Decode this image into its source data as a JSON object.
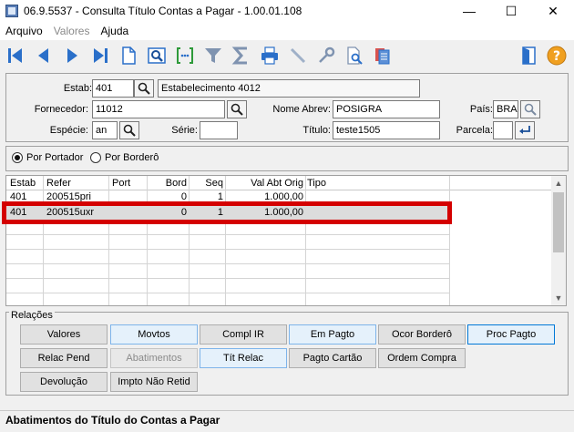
{
  "window": {
    "title": "06.9.5537 - Consulta Título Contas a Pagar - 1.00.01.108",
    "minimize": "—",
    "maximize": "☐",
    "close": "✕"
  },
  "menu": {
    "items": [
      "Arquivo",
      "Valores",
      "Ajuda"
    ]
  },
  "toolbar": {
    "icons": [
      "first-record-icon",
      "previous-record-icon",
      "next-record-icon",
      "last-record-icon",
      "new-document-icon",
      "search-icon",
      "goto-icon",
      "filter-icon",
      "sum-icon",
      "print-icon",
      "pen-icon",
      "key-icon",
      "document-search-icon",
      "documents-icon",
      "exit-icon",
      "help-icon"
    ]
  },
  "form": {
    "estab_label": "Estab:",
    "estab_value": "401",
    "estab_desc": "Estabelecimento 4012",
    "fornecedor_label": "Fornecedor:",
    "fornecedor_value": "11012",
    "nome_abrev_label": "Nome Abrev:",
    "nome_abrev_value": "POSIGRA",
    "pais_label": "País:",
    "pais_value": "BRA",
    "especie_label": "Espécie:",
    "especie_value": "an",
    "serie_label": "Série:",
    "serie_value": "",
    "titulo_label": "Título:",
    "titulo_value": "teste1505",
    "parcela_label": "Parcela:",
    "parcela_value": ""
  },
  "radios": {
    "por_portador": "Por Portador",
    "por_bordero": "Por Borderô",
    "selected": "por_portador"
  },
  "grid": {
    "columns": [
      "Estab",
      "Refer",
      "Port",
      "Bord",
      "Seq",
      "Val Abt Orig",
      "Tipo"
    ],
    "rows": [
      {
        "estab": "401",
        "refer": "200515pri",
        "port": "",
        "bord": "0",
        "seq": "1",
        "val": "1.000,00",
        "tipo": ""
      },
      {
        "estab": "401",
        "refer": "200515uxr",
        "port": "",
        "bord": "0",
        "seq": "1",
        "val": "1.000,00",
        "tipo": ""
      }
    ],
    "selected_row": 1
  },
  "relacoes": {
    "title": "Relações",
    "buttons": [
      "Valores",
      "Movtos",
      "Compl IR",
      "Em Pagto",
      "Ocor Borderô",
      "Proc Pagto",
      "Relac Pend",
      "Abatimentos",
      "Tít Relac",
      "Pagto Cartão",
      "Ordem Compra",
      "Devolução",
      "Impto Não Retid"
    ]
  },
  "status": {
    "text": "Abatimentos do Título do Contas a Pagar"
  },
  "colors": {
    "highlight": "#d40000",
    "toolbar_blue": "#2a6fc9"
  }
}
